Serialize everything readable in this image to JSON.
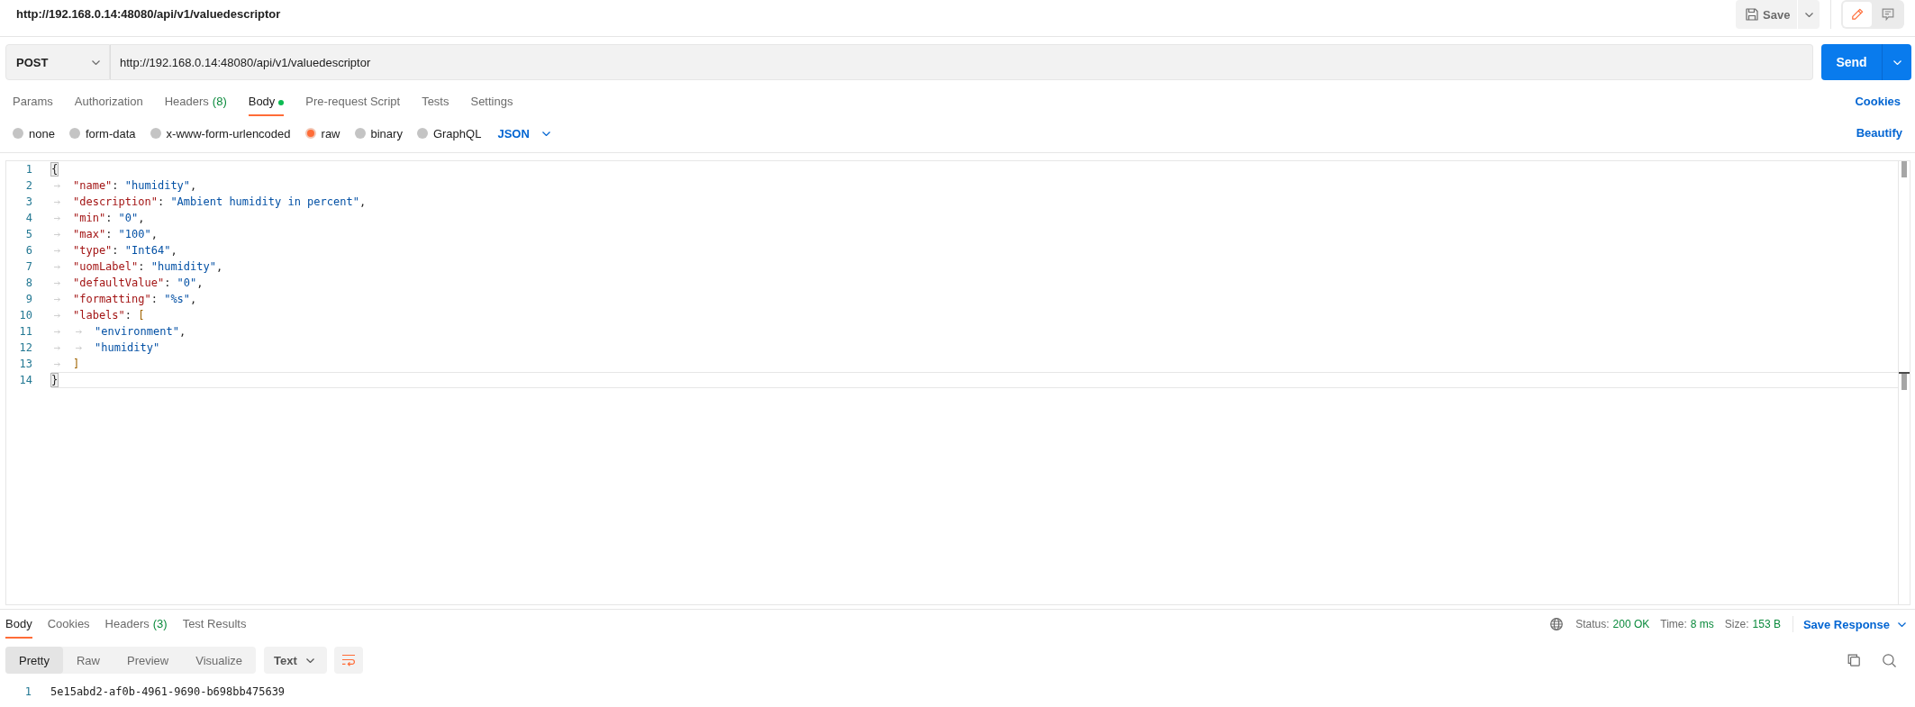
{
  "request_title": "http://192.168.0.14:48080/api/v1/valuedescriptor",
  "save_button": {
    "label": "Save"
  },
  "view_modes": [
    {
      "kind": "edit",
      "selected": true
    },
    {
      "kind": "comments",
      "selected": false
    }
  ],
  "request": {
    "method": "POST",
    "url": "http://192.168.0.14:48080/api/v1/valuedescriptor",
    "send_label": "Send"
  },
  "request_tabs": [
    {
      "label": "Params",
      "selected": false,
      "modified": false
    },
    {
      "label": "Authorization",
      "selected": false,
      "modified": false
    },
    {
      "label": "Headers",
      "count": "(8)",
      "selected": false,
      "modified": false
    },
    {
      "label": "Body",
      "selected": true,
      "modified": true
    },
    {
      "label": "Pre-request Script",
      "selected": false,
      "modified": false
    },
    {
      "label": "Tests",
      "selected": false,
      "modified": false
    },
    {
      "label": "Settings",
      "selected": false,
      "modified": false
    }
  ],
  "cookies_link": "Cookies",
  "body_modes": [
    {
      "label": "none",
      "selected": false
    },
    {
      "label": "form-data",
      "selected": false
    },
    {
      "label": "x-www-form-urlencoded",
      "selected": false
    },
    {
      "label": "raw",
      "selected": true
    },
    {
      "label": "binary",
      "selected": false
    },
    {
      "label": "GraphQL",
      "selected": false
    }
  ],
  "body_language": "JSON",
  "beautify_link": "Beautify",
  "editor": {
    "lines": [
      {
        "number": "1",
        "current": false,
        "tokens": [
          {
            "kind": "brace_match",
            "text": "{"
          }
        ]
      },
      {
        "number": "2",
        "current": false,
        "tokens": [
          {
            "kind": "tab"
          },
          {
            "kind": "key",
            "text": "\"name\""
          },
          {
            "kind": "punct",
            "text": ": "
          },
          {
            "kind": "string",
            "text": "\"humidity\""
          },
          {
            "kind": "punct",
            "text": ","
          }
        ]
      },
      {
        "number": "3",
        "current": false,
        "tokens": [
          {
            "kind": "tab"
          },
          {
            "kind": "key",
            "text": "\"description\""
          },
          {
            "kind": "punct",
            "text": ": "
          },
          {
            "kind": "string",
            "text": "\"Ambient humidity in percent\""
          },
          {
            "kind": "punct",
            "text": ","
          }
        ]
      },
      {
        "number": "4",
        "current": false,
        "tokens": [
          {
            "kind": "tab"
          },
          {
            "kind": "key",
            "text": "\"min\""
          },
          {
            "kind": "punct",
            "text": ": "
          },
          {
            "kind": "string",
            "text": "\"0\""
          },
          {
            "kind": "punct",
            "text": ","
          }
        ]
      },
      {
        "number": "5",
        "current": false,
        "tokens": [
          {
            "kind": "tab"
          },
          {
            "kind": "key",
            "text": "\"max\""
          },
          {
            "kind": "punct",
            "text": ": "
          },
          {
            "kind": "string",
            "text": "\"100\""
          },
          {
            "kind": "punct",
            "text": ","
          }
        ]
      },
      {
        "number": "6",
        "current": false,
        "tokens": [
          {
            "kind": "tab"
          },
          {
            "kind": "key",
            "text": "\"type\""
          },
          {
            "kind": "punct",
            "text": ": "
          },
          {
            "kind": "string",
            "text": "\"Int64\""
          },
          {
            "kind": "punct",
            "text": ","
          }
        ]
      },
      {
        "number": "7",
        "current": false,
        "tokens": [
          {
            "kind": "tab"
          },
          {
            "kind": "key",
            "text": "\"uomLabel\""
          },
          {
            "kind": "punct",
            "text": ": "
          },
          {
            "kind": "string",
            "text": "\"humidity\""
          },
          {
            "kind": "punct",
            "text": ","
          }
        ]
      },
      {
        "number": "8",
        "current": false,
        "tokens": [
          {
            "kind": "tab"
          },
          {
            "kind": "key",
            "text": "\"defaultValue\""
          },
          {
            "kind": "punct",
            "text": ": "
          },
          {
            "kind": "string",
            "text": "\"0\""
          },
          {
            "kind": "punct",
            "text": ","
          }
        ]
      },
      {
        "number": "9",
        "current": false,
        "tokens": [
          {
            "kind": "tab"
          },
          {
            "kind": "key",
            "text": "\"formatting\""
          },
          {
            "kind": "punct",
            "text": ": "
          },
          {
            "kind": "string",
            "text": "\"%s\""
          },
          {
            "kind": "punct",
            "text": ","
          }
        ]
      },
      {
        "number": "10",
        "current": false,
        "tokens": [
          {
            "kind": "tab"
          },
          {
            "kind": "key",
            "text": "\"labels\""
          },
          {
            "kind": "punct",
            "text": ": "
          },
          {
            "kind": "bracket",
            "text": "["
          }
        ]
      },
      {
        "number": "11",
        "current": false,
        "tokens": [
          {
            "kind": "tab"
          },
          {
            "kind": "tab"
          },
          {
            "kind": "string",
            "text": "\"environment\""
          },
          {
            "kind": "punct",
            "text": ","
          }
        ]
      },
      {
        "number": "12",
        "current": false,
        "tokens": [
          {
            "kind": "tab"
          },
          {
            "kind": "tab"
          },
          {
            "kind": "string",
            "text": "\"humidity\""
          }
        ]
      },
      {
        "number": "13",
        "current": false,
        "tokens": [
          {
            "kind": "tab"
          },
          {
            "kind": "bracket",
            "text": "]"
          }
        ]
      },
      {
        "number": "14",
        "current": true,
        "tokens": [
          {
            "kind": "brace_match",
            "text": "}"
          }
        ]
      }
    ]
  },
  "response": {
    "tabs": [
      {
        "label": "Body",
        "selected": true
      },
      {
        "label": "Cookies",
        "selected": false
      },
      {
        "label": "Headers",
        "count": "(3)",
        "selected": false
      },
      {
        "label": "Test Results",
        "selected": false
      }
    ],
    "metrics": [
      {
        "label": "Status:",
        "value": "200 OK"
      },
      {
        "label": "Time:",
        "value": "8 ms"
      },
      {
        "label": "Size:",
        "value": "153 B"
      }
    ],
    "save_response_label": "Save Response",
    "views": [
      {
        "label": "Pretty",
        "selected": true
      },
      {
        "label": "Raw",
        "selected": false
      },
      {
        "label": "Preview",
        "selected": false
      },
      {
        "label": "Visualize",
        "selected": false
      }
    ],
    "format": "Text",
    "wrap_lines": true,
    "lines": [
      {
        "number": "1",
        "text": "5e15abd2-af0b-4961-9690-b698bb475639"
      }
    ]
  }
}
